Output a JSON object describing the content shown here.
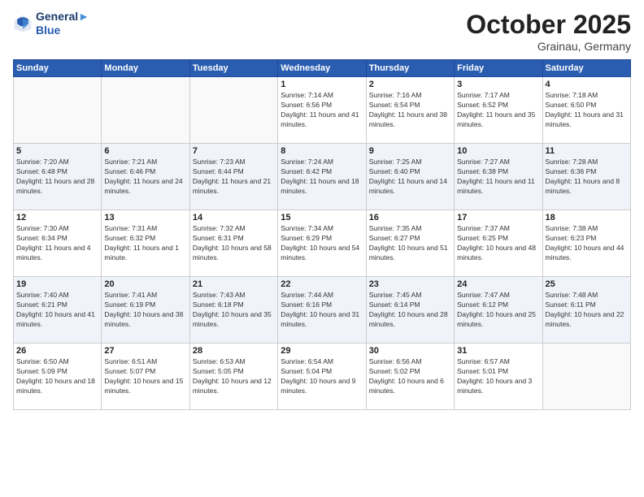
{
  "logo": {
    "line1": "General",
    "line2": "Blue"
  },
  "header": {
    "month": "October 2025",
    "location": "Grainau, Germany"
  },
  "weekdays": [
    "Sunday",
    "Monday",
    "Tuesday",
    "Wednesday",
    "Thursday",
    "Friday",
    "Saturday"
  ],
  "weeks": [
    [
      {
        "day": "",
        "sunrise": "",
        "sunset": "",
        "daylight": ""
      },
      {
        "day": "",
        "sunrise": "",
        "sunset": "",
        "daylight": ""
      },
      {
        "day": "",
        "sunrise": "",
        "sunset": "",
        "daylight": ""
      },
      {
        "day": "1",
        "sunrise": "Sunrise: 7:14 AM",
        "sunset": "Sunset: 6:56 PM",
        "daylight": "Daylight: 11 hours and 41 minutes."
      },
      {
        "day": "2",
        "sunrise": "Sunrise: 7:16 AM",
        "sunset": "Sunset: 6:54 PM",
        "daylight": "Daylight: 11 hours and 38 minutes."
      },
      {
        "day": "3",
        "sunrise": "Sunrise: 7:17 AM",
        "sunset": "Sunset: 6:52 PM",
        "daylight": "Daylight: 11 hours and 35 minutes."
      },
      {
        "day": "4",
        "sunrise": "Sunrise: 7:18 AM",
        "sunset": "Sunset: 6:50 PM",
        "daylight": "Daylight: 11 hours and 31 minutes."
      }
    ],
    [
      {
        "day": "5",
        "sunrise": "Sunrise: 7:20 AM",
        "sunset": "Sunset: 6:48 PM",
        "daylight": "Daylight: 11 hours and 28 minutes."
      },
      {
        "day": "6",
        "sunrise": "Sunrise: 7:21 AM",
        "sunset": "Sunset: 6:46 PM",
        "daylight": "Daylight: 11 hours and 24 minutes."
      },
      {
        "day": "7",
        "sunrise": "Sunrise: 7:23 AM",
        "sunset": "Sunset: 6:44 PM",
        "daylight": "Daylight: 11 hours and 21 minutes."
      },
      {
        "day": "8",
        "sunrise": "Sunrise: 7:24 AM",
        "sunset": "Sunset: 6:42 PM",
        "daylight": "Daylight: 11 hours and 18 minutes."
      },
      {
        "day": "9",
        "sunrise": "Sunrise: 7:25 AM",
        "sunset": "Sunset: 6:40 PM",
        "daylight": "Daylight: 11 hours and 14 minutes."
      },
      {
        "day": "10",
        "sunrise": "Sunrise: 7:27 AM",
        "sunset": "Sunset: 6:38 PM",
        "daylight": "Daylight: 11 hours and 11 minutes."
      },
      {
        "day": "11",
        "sunrise": "Sunrise: 7:28 AM",
        "sunset": "Sunset: 6:36 PM",
        "daylight": "Daylight: 11 hours and 8 minutes."
      }
    ],
    [
      {
        "day": "12",
        "sunrise": "Sunrise: 7:30 AM",
        "sunset": "Sunset: 6:34 PM",
        "daylight": "Daylight: 11 hours and 4 minutes."
      },
      {
        "day": "13",
        "sunrise": "Sunrise: 7:31 AM",
        "sunset": "Sunset: 6:32 PM",
        "daylight": "Daylight: 11 hours and 1 minute."
      },
      {
        "day": "14",
        "sunrise": "Sunrise: 7:32 AM",
        "sunset": "Sunset: 6:31 PM",
        "daylight": "Daylight: 10 hours and 58 minutes."
      },
      {
        "day": "15",
        "sunrise": "Sunrise: 7:34 AM",
        "sunset": "Sunset: 6:29 PM",
        "daylight": "Daylight: 10 hours and 54 minutes."
      },
      {
        "day": "16",
        "sunrise": "Sunrise: 7:35 AM",
        "sunset": "Sunset: 6:27 PM",
        "daylight": "Daylight: 10 hours and 51 minutes."
      },
      {
        "day": "17",
        "sunrise": "Sunrise: 7:37 AM",
        "sunset": "Sunset: 6:25 PM",
        "daylight": "Daylight: 10 hours and 48 minutes."
      },
      {
        "day": "18",
        "sunrise": "Sunrise: 7:38 AM",
        "sunset": "Sunset: 6:23 PM",
        "daylight": "Daylight: 10 hours and 44 minutes."
      }
    ],
    [
      {
        "day": "19",
        "sunrise": "Sunrise: 7:40 AM",
        "sunset": "Sunset: 6:21 PM",
        "daylight": "Daylight: 10 hours and 41 minutes."
      },
      {
        "day": "20",
        "sunrise": "Sunrise: 7:41 AM",
        "sunset": "Sunset: 6:19 PM",
        "daylight": "Daylight: 10 hours and 38 minutes."
      },
      {
        "day": "21",
        "sunrise": "Sunrise: 7:43 AM",
        "sunset": "Sunset: 6:18 PM",
        "daylight": "Daylight: 10 hours and 35 minutes."
      },
      {
        "day": "22",
        "sunrise": "Sunrise: 7:44 AM",
        "sunset": "Sunset: 6:16 PM",
        "daylight": "Daylight: 10 hours and 31 minutes."
      },
      {
        "day": "23",
        "sunrise": "Sunrise: 7:45 AM",
        "sunset": "Sunset: 6:14 PM",
        "daylight": "Daylight: 10 hours and 28 minutes."
      },
      {
        "day": "24",
        "sunrise": "Sunrise: 7:47 AM",
        "sunset": "Sunset: 6:12 PM",
        "daylight": "Daylight: 10 hours and 25 minutes."
      },
      {
        "day": "25",
        "sunrise": "Sunrise: 7:48 AM",
        "sunset": "Sunset: 6:11 PM",
        "daylight": "Daylight: 10 hours and 22 minutes."
      }
    ],
    [
      {
        "day": "26",
        "sunrise": "Sunrise: 6:50 AM",
        "sunset": "Sunset: 5:09 PM",
        "daylight": "Daylight: 10 hours and 18 minutes."
      },
      {
        "day": "27",
        "sunrise": "Sunrise: 6:51 AM",
        "sunset": "Sunset: 5:07 PM",
        "daylight": "Daylight: 10 hours and 15 minutes."
      },
      {
        "day": "28",
        "sunrise": "Sunrise: 6:53 AM",
        "sunset": "Sunset: 5:05 PM",
        "daylight": "Daylight: 10 hours and 12 minutes."
      },
      {
        "day": "29",
        "sunrise": "Sunrise: 6:54 AM",
        "sunset": "Sunset: 5:04 PM",
        "daylight": "Daylight: 10 hours and 9 minutes."
      },
      {
        "day": "30",
        "sunrise": "Sunrise: 6:56 AM",
        "sunset": "Sunset: 5:02 PM",
        "daylight": "Daylight: 10 hours and 6 minutes."
      },
      {
        "day": "31",
        "sunrise": "Sunrise: 6:57 AM",
        "sunset": "Sunset: 5:01 PM",
        "daylight": "Daylight: 10 hours and 3 minutes."
      },
      {
        "day": "",
        "sunrise": "",
        "sunset": "",
        "daylight": ""
      }
    ]
  ]
}
